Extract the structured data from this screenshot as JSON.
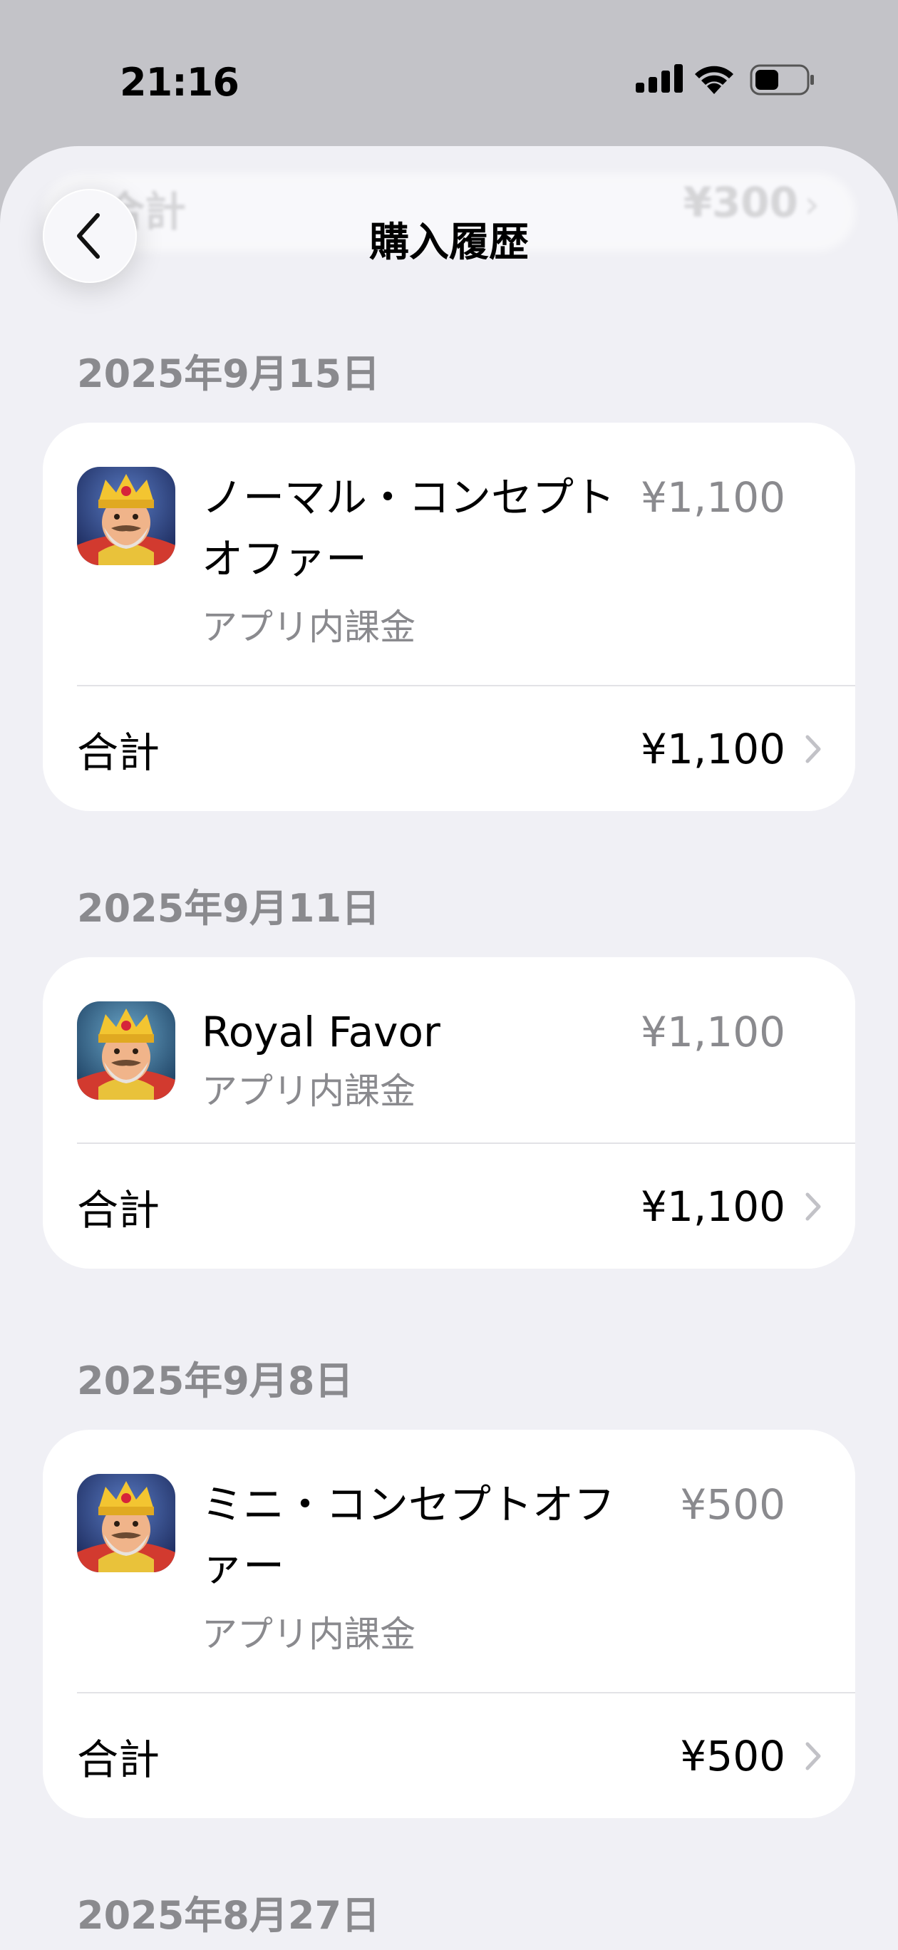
{
  "status": {
    "time": "21:16"
  },
  "header": {
    "title": "購入履歴"
  },
  "ghost": {
    "label": "合計",
    "price": "¥300"
  },
  "purchases": [
    {
      "date": "2025年9月15日",
      "title_line1": "ノーマル・コンセプト",
      "title_line2": "オファー",
      "subtitle": "アプリ内課金",
      "price": "¥1,100",
      "total_label": "合計",
      "total": "¥1,100"
    },
    {
      "date": "2025年9月11日",
      "title_line1": "Royal Favor",
      "title_line2": "",
      "subtitle": "アプリ内課金",
      "price": "¥1,100",
      "total_label": "合計",
      "total": "¥1,100"
    },
    {
      "date": "2025年9月8日",
      "title_line1": "ミニ・コンセプトオフ",
      "title_line2": "ァー",
      "subtitle": "アプリ内課金",
      "price": "¥500",
      "total_label": "合計",
      "total": "¥500"
    },
    {
      "date": "2025年8月27日"
    }
  ]
}
